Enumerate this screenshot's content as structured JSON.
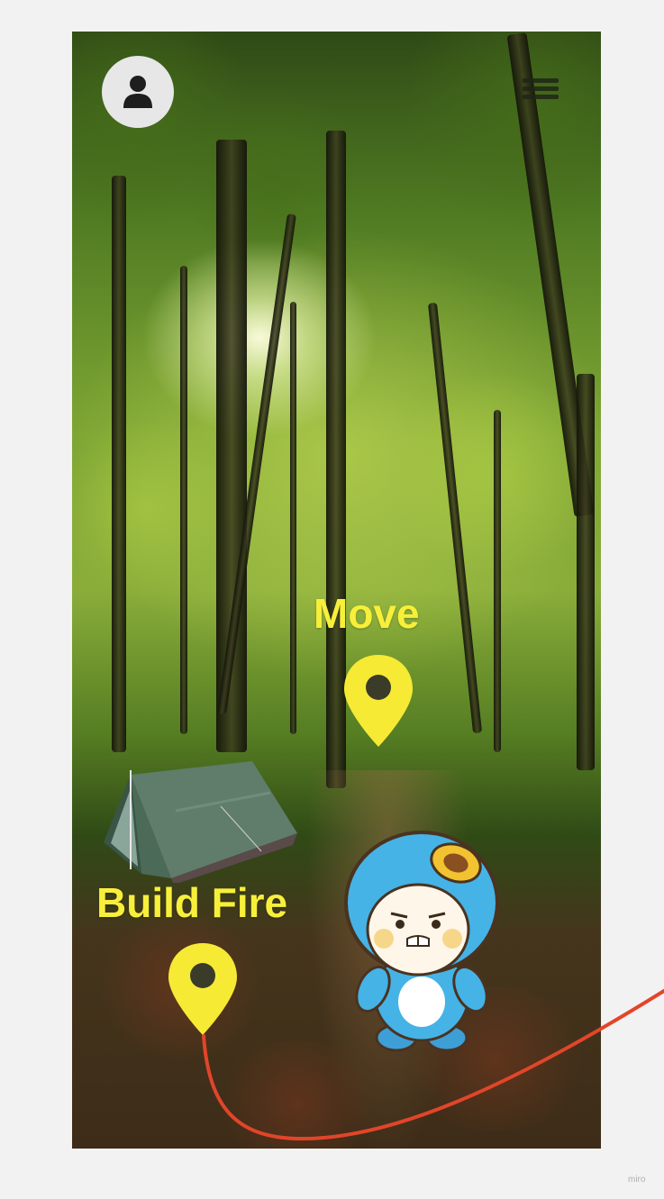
{
  "scene": {
    "name": "forest-clearing"
  },
  "header": {
    "profile_icon": "user-icon",
    "menu_icon": "hamburger-menu-icon"
  },
  "actions": {
    "move": {
      "label": "Move",
      "icon": "map-pin-icon"
    },
    "build_fire": {
      "label": "Build Fire",
      "icon": "map-pin-icon"
    }
  },
  "objects": {
    "tent": "tent",
    "character": "blue-hooded-mascot"
  },
  "colors": {
    "label_yellow": "#f8ef3a",
    "pin_yellow": "#f6ea35",
    "route_red": "#e2452a",
    "character_blue": "#45b3e6"
  },
  "watermark": "miro"
}
